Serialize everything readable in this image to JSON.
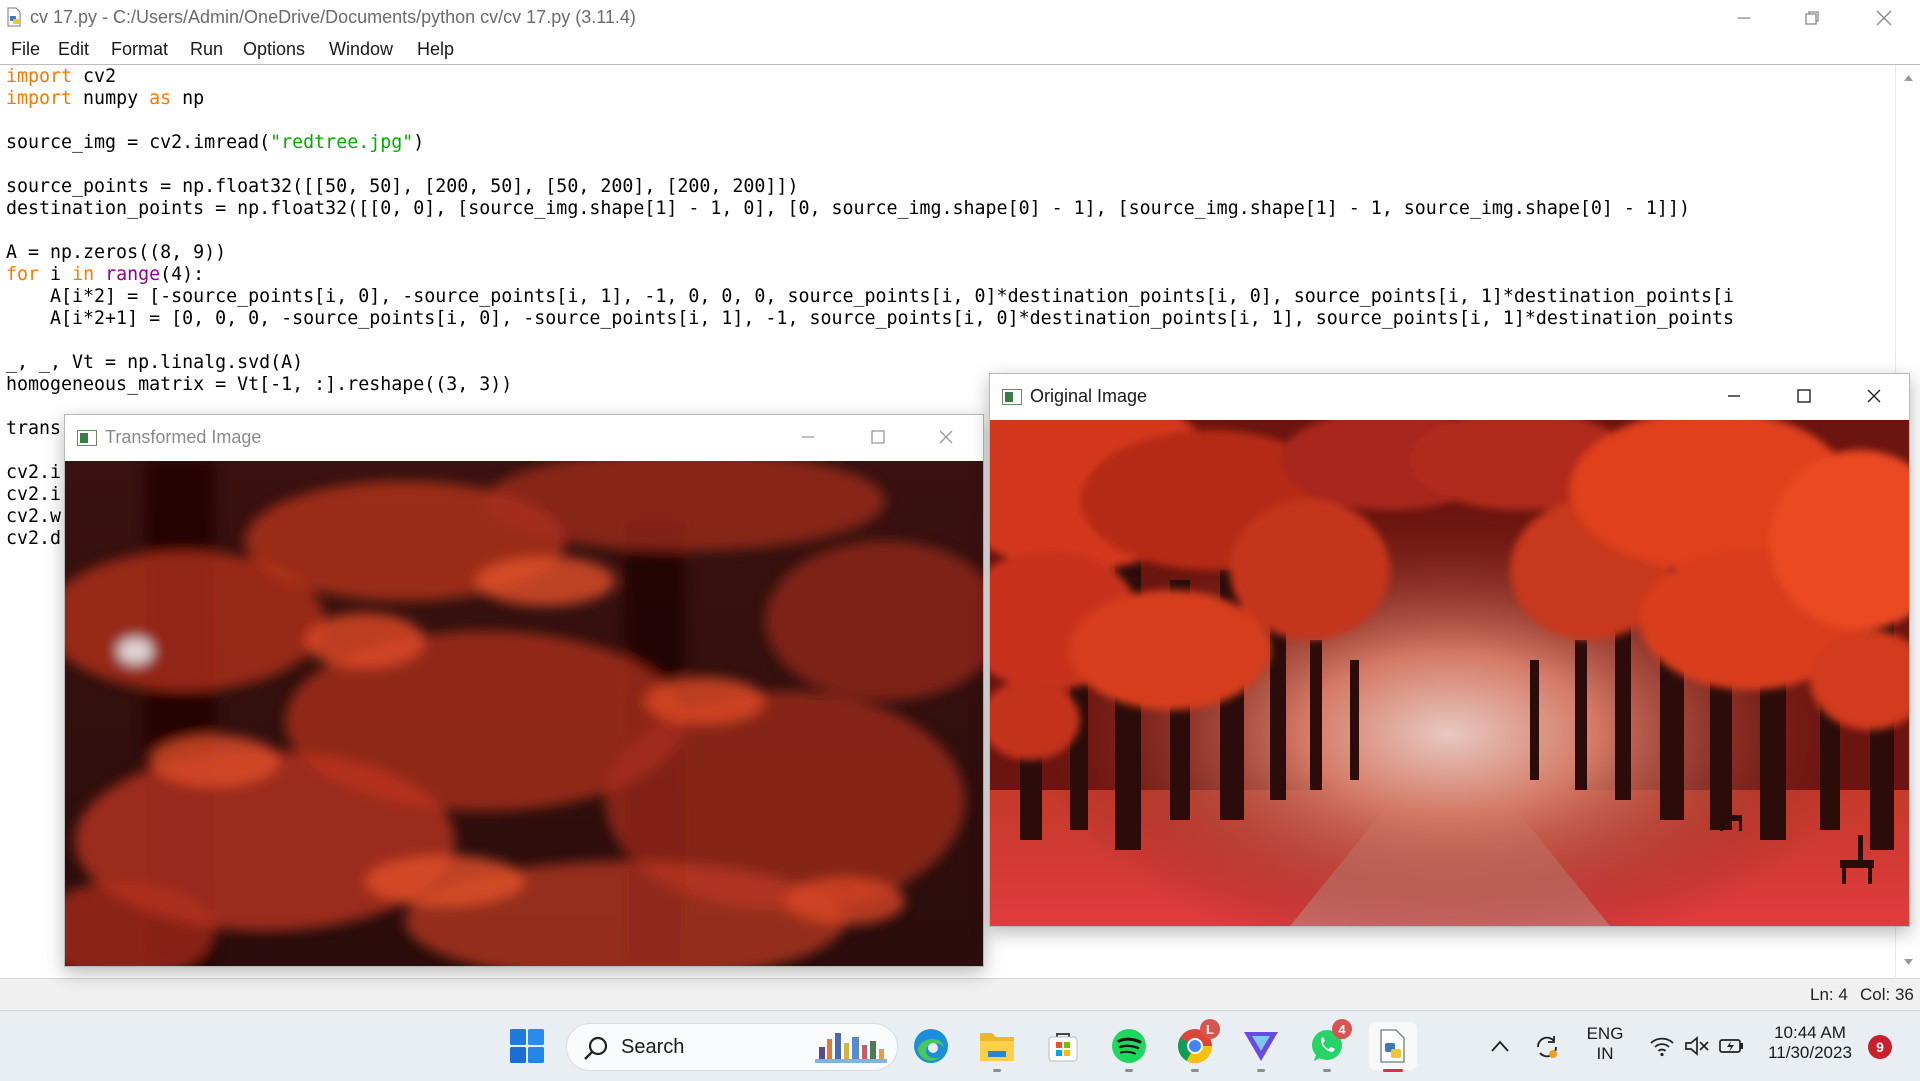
{
  "window": {
    "title": "cv 17.py - C:/Users/Admin/OneDrive/Documents/python cv/cv 17.py (3.11.4)"
  },
  "menu": [
    "File",
    "Edit",
    "Format",
    "Run",
    "Options",
    "Window",
    "Help"
  ],
  "code": {
    "lines": [
      [
        {
          "t": "import",
          "c": "kw"
        },
        {
          "t": " cv2"
        }
      ],
      [
        {
          "t": "import",
          "c": "kw"
        },
        {
          "t": " numpy "
        },
        {
          "t": "as",
          "c": "kw"
        },
        {
          "t": " np"
        }
      ],
      [],
      [
        {
          "t": "source_img = cv2.imread("
        },
        {
          "t": "\"redtree.jpg\"",
          "c": "str"
        },
        {
          "t": ")"
        }
      ],
      [],
      [
        {
          "t": "source_points = np.float32([[50, 50], [200, 50], [50, 200], [200, 200]])"
        }
      ],
      [
        {
          "t": "destination_points = np.float32([[0, 0], [source_img.shape[1] - 1, 0], [0, source_img.shape[0] - 1], [source_img.shape[1] - 1, source_img.shape[0] - 1]])"
        }
      ],
      [],
      [
        {
          "t": "A = np.zeros((8, 9))"
        }
      ],
      [
        {
          "t": "for",
          "c": "kw"
        },
        {
          "t": " i "
        },
        {
          "t": "in",
          "c": "kw"
        },
        {
          "t": " "
        },
        {
          "t": "range",
          "c": "bi"
        },
        {
          "t": "(4):"
        }
      ],
      [
        {
          "t": "    A[i*2] = [-source_points[i, 0], -source_points[i, 1], -1, 0, 0, 0, source_points[i, 0]*destination_points[i, 0], source_points[i, 1]*destination_points[i"
        }
      ],
      [
        {
          "t": "    A[i*2+1] = [0, 0, 0, -source_points[i, 0], -source_points[i, 1], -1, source_points[i, 0]*destination_points[i, 1], source_points[i, 1]*destination_points"
        }
      ],
      [],
      [
        {
          "t": "_, _, Vt = np.linalg.svd(A)"
        }
      ],
      [
        {
          "t": "homogeneous_matrix = Vt[-1, :].reshape((3, 3))"
        }
      ],
      [],
      [
        {
          "t": "trans"
        }
      ],
      [],
      [
        {
          "t": "cv2.i"
        }
      ],
      [
        {
          "t": "cv2.i"
        }
      ],
      [
        {
          "t": "cv2.w"
        }
      ],
      [
        {
          "t": "cv2.d"
        }
      ]
    ]
  },
  "status": {
    "line": "Ln: 4",
    "col": "Col: 36"
  },
  "windows": {
    "transformed": {
      "title": "Transformed Image"
    },
    "original": {
      "title": "Original Image"
    }
  },
  "taskbar": {
    "search_label": "Search",
    "chrome_badge": "L",
    "whatsapp_badge": "4",
    "language_top": "ENG",
    "language_bottom": "IN",
    "time": "10:44 AM",
    "date": "11/30/2023",
    "notification_count": "9"
  },
  "colors": {
    "keyword": "#ff7700",
    "builtin": "#900090",
    "string": "#00aa00",
    "foliage": "#d63a1e"
  }
}
